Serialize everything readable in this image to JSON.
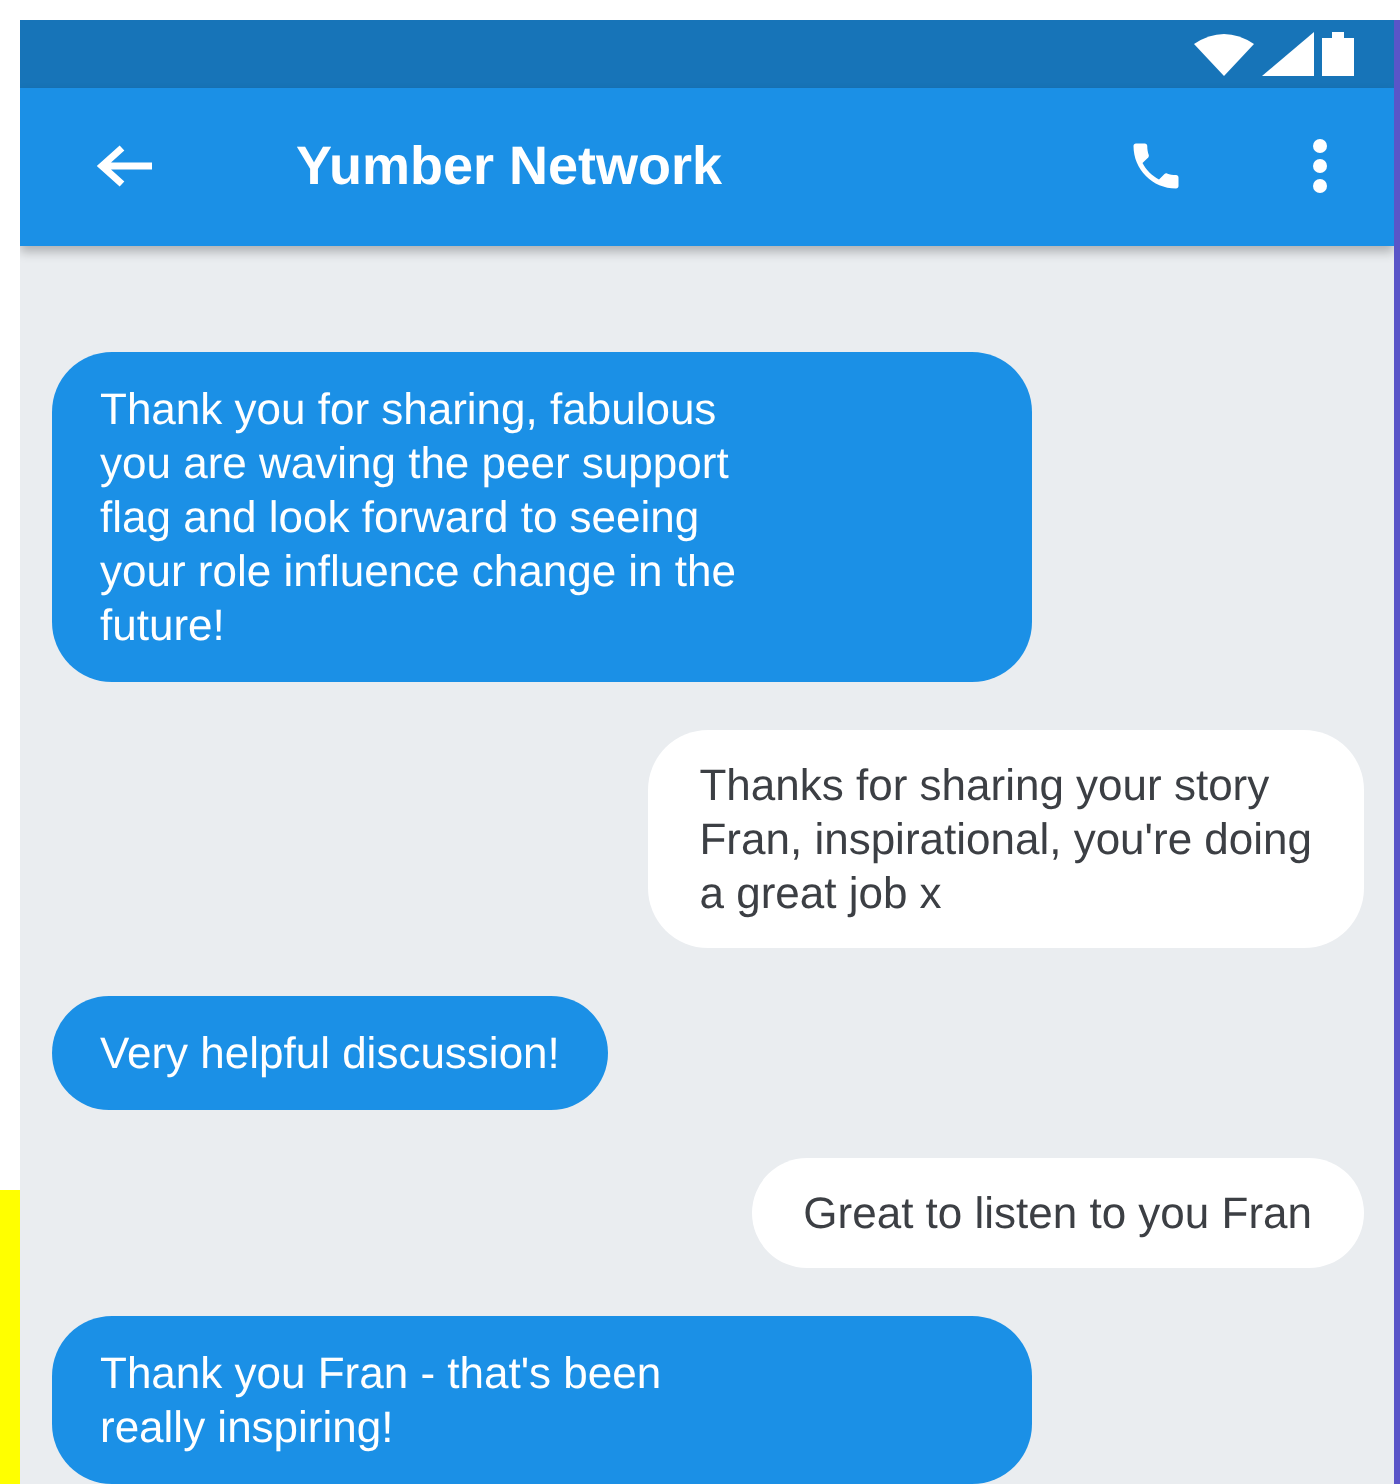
{
  "app_bar": {
    "title": "Yumber Network"
  },
  "messages": [
    {
      "kind": "incoming",
      "lines": [
        "Thank you for sharing, fabulous",
        "you are waving the peer support",
        "flag and look forward to seeing",
        "your role influence change in the",
        "future!"
      ]
    },
    {
      "kind": "outgoing",
      "lines": [
        "Thanks for sharing your story",
        "Fran, inspirational, you're doing",
        "a great job x"
      ]
    },
    {
      "kind": "incoming",
      "lines": [
        "Very helpful discussion!"
      ]
    },
    {
      "kind": "outgoing",
      "lines": [
        "Great to listen to you Fran"
      ]
    },
    {
      "kind": "incoming",
      "lines": [
        "Thank you Fran - that's been",
        "really inspiring!"
      ]
    }
  ]
}
